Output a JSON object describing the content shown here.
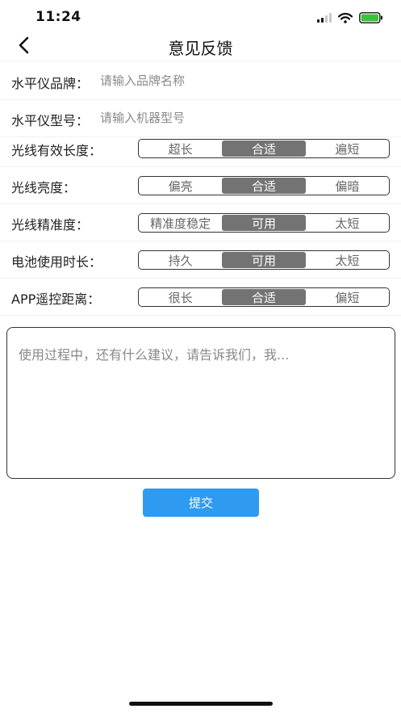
{
  "status_bar": {
    "time": "11:24"
  },
  "nav": {
    "title": "意见反馈"
  },
  "fields": [
    {
      "label": "水平仪品牌：",
      "placeholder": "请输入品牌名称",
      "value": ""
    },
    {
      "label": "水平仪型号：",
      "placeholder": "请输入机器型号",
      "value": ""
    }
  ],
  "ratings": [
    {
      "label": "光线有效长度：",
      "options": [
        "超长",
        "合适",
        "遍短"
      ],
      "selected": "合适"
    },
    {
      "label": "光线亮度：",
      "options": [
        "偏亮",
        "合适",
        "偏暗"
      ],
      "selected": "合适"
    },
    {
      "label": "光线精准度：",
      "options": [
        "精准度稳定",
        "可用",
        "太短"
      ],
      "selected": "可用"
    },
    {
      "label": "电池使用时长：",
      "options": [
        "持久",
        "可用",
        "太短"
      ],
      "selected": "可用"
    },
    {
      "label": "APP遥控距离：",
      "options": [
        "很长",
        "合适",
        "偏短"
      ],
      "selected": "合适"
    }
  ],
  "feedback": {
    "placeholder": "使用过程中，还有什么建议，请告诉我们，我...",
    "value": ""
  },
  "submit": {
    "label": "提交"
  },
  "colors": {
    "accent": "#2f9bf0",
    "segment_active": "#737373"
  }
}
